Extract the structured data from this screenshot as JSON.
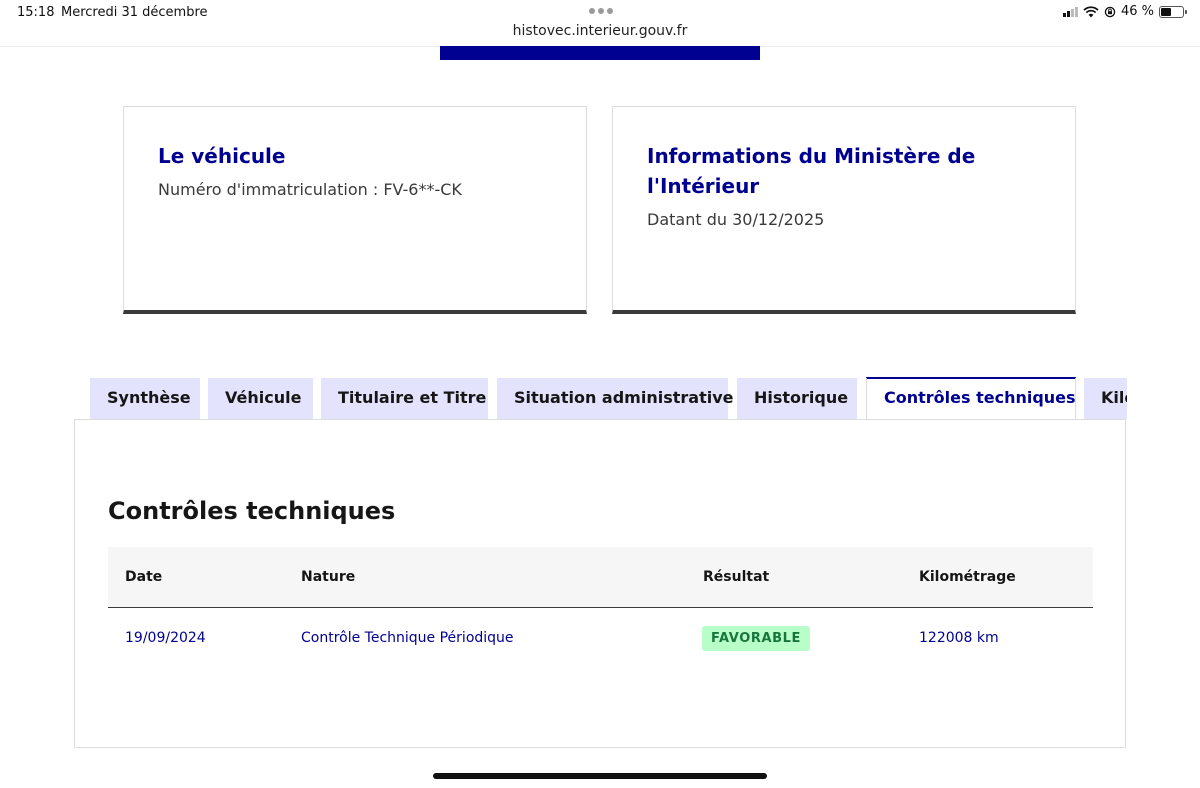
{
  "status_bar": {
    "time": "15:18",
    "date": "Mercredi 31 décembre",
    "url": "histovec.interieur.gouv.fr",
    "battery": "46 %"
  },
  "cards": {
    "vehicle": {
      "title": "Le véhicule",
      "text": "Numéro d'immatriculation : FV-6**-CK"
    },
    "ministry": {
      "title": "Informations du Ministère de l'Intérieur",
      "text": "Datant du 30/12/2025"
    }
  },
  "tabs": [
    {
      "label": "Synthèse",
      "active": false
    },
    {
      "label": "Véhicule",
      "active": false
    },
    {
      "label": "Titulaire et Titre",
      "active": false
    },
    {
      "label": "Situation administrative",
      "active": false
    },
    {
      "label": "Historique",
      "active": false
    },
    {
      "label": "Contrôles techniques",
      "active": true
    },
    {
      "label": "Kilométrage",
      "active": false
    }
  ],
  "section": {
    "title": "Contrôles techniques",
    "columns": [
      "Date",
      "Nature",
      "Résultat",
      "Kilométrage"
    ],
    "rows": [
      {
        "date": "19/09/2024",
        "nature": "Contrôle Technique Périodique",
        "result": "FAVORABLE",
        "km": "122008 km"
      }
    ]
  },
  "colors": {
    "primary": "#000091",
    "tab_bg": "#e3e3fd",
    "success_bg": "#b8fec9",
    "success_text": "#18753c"
  }
}
